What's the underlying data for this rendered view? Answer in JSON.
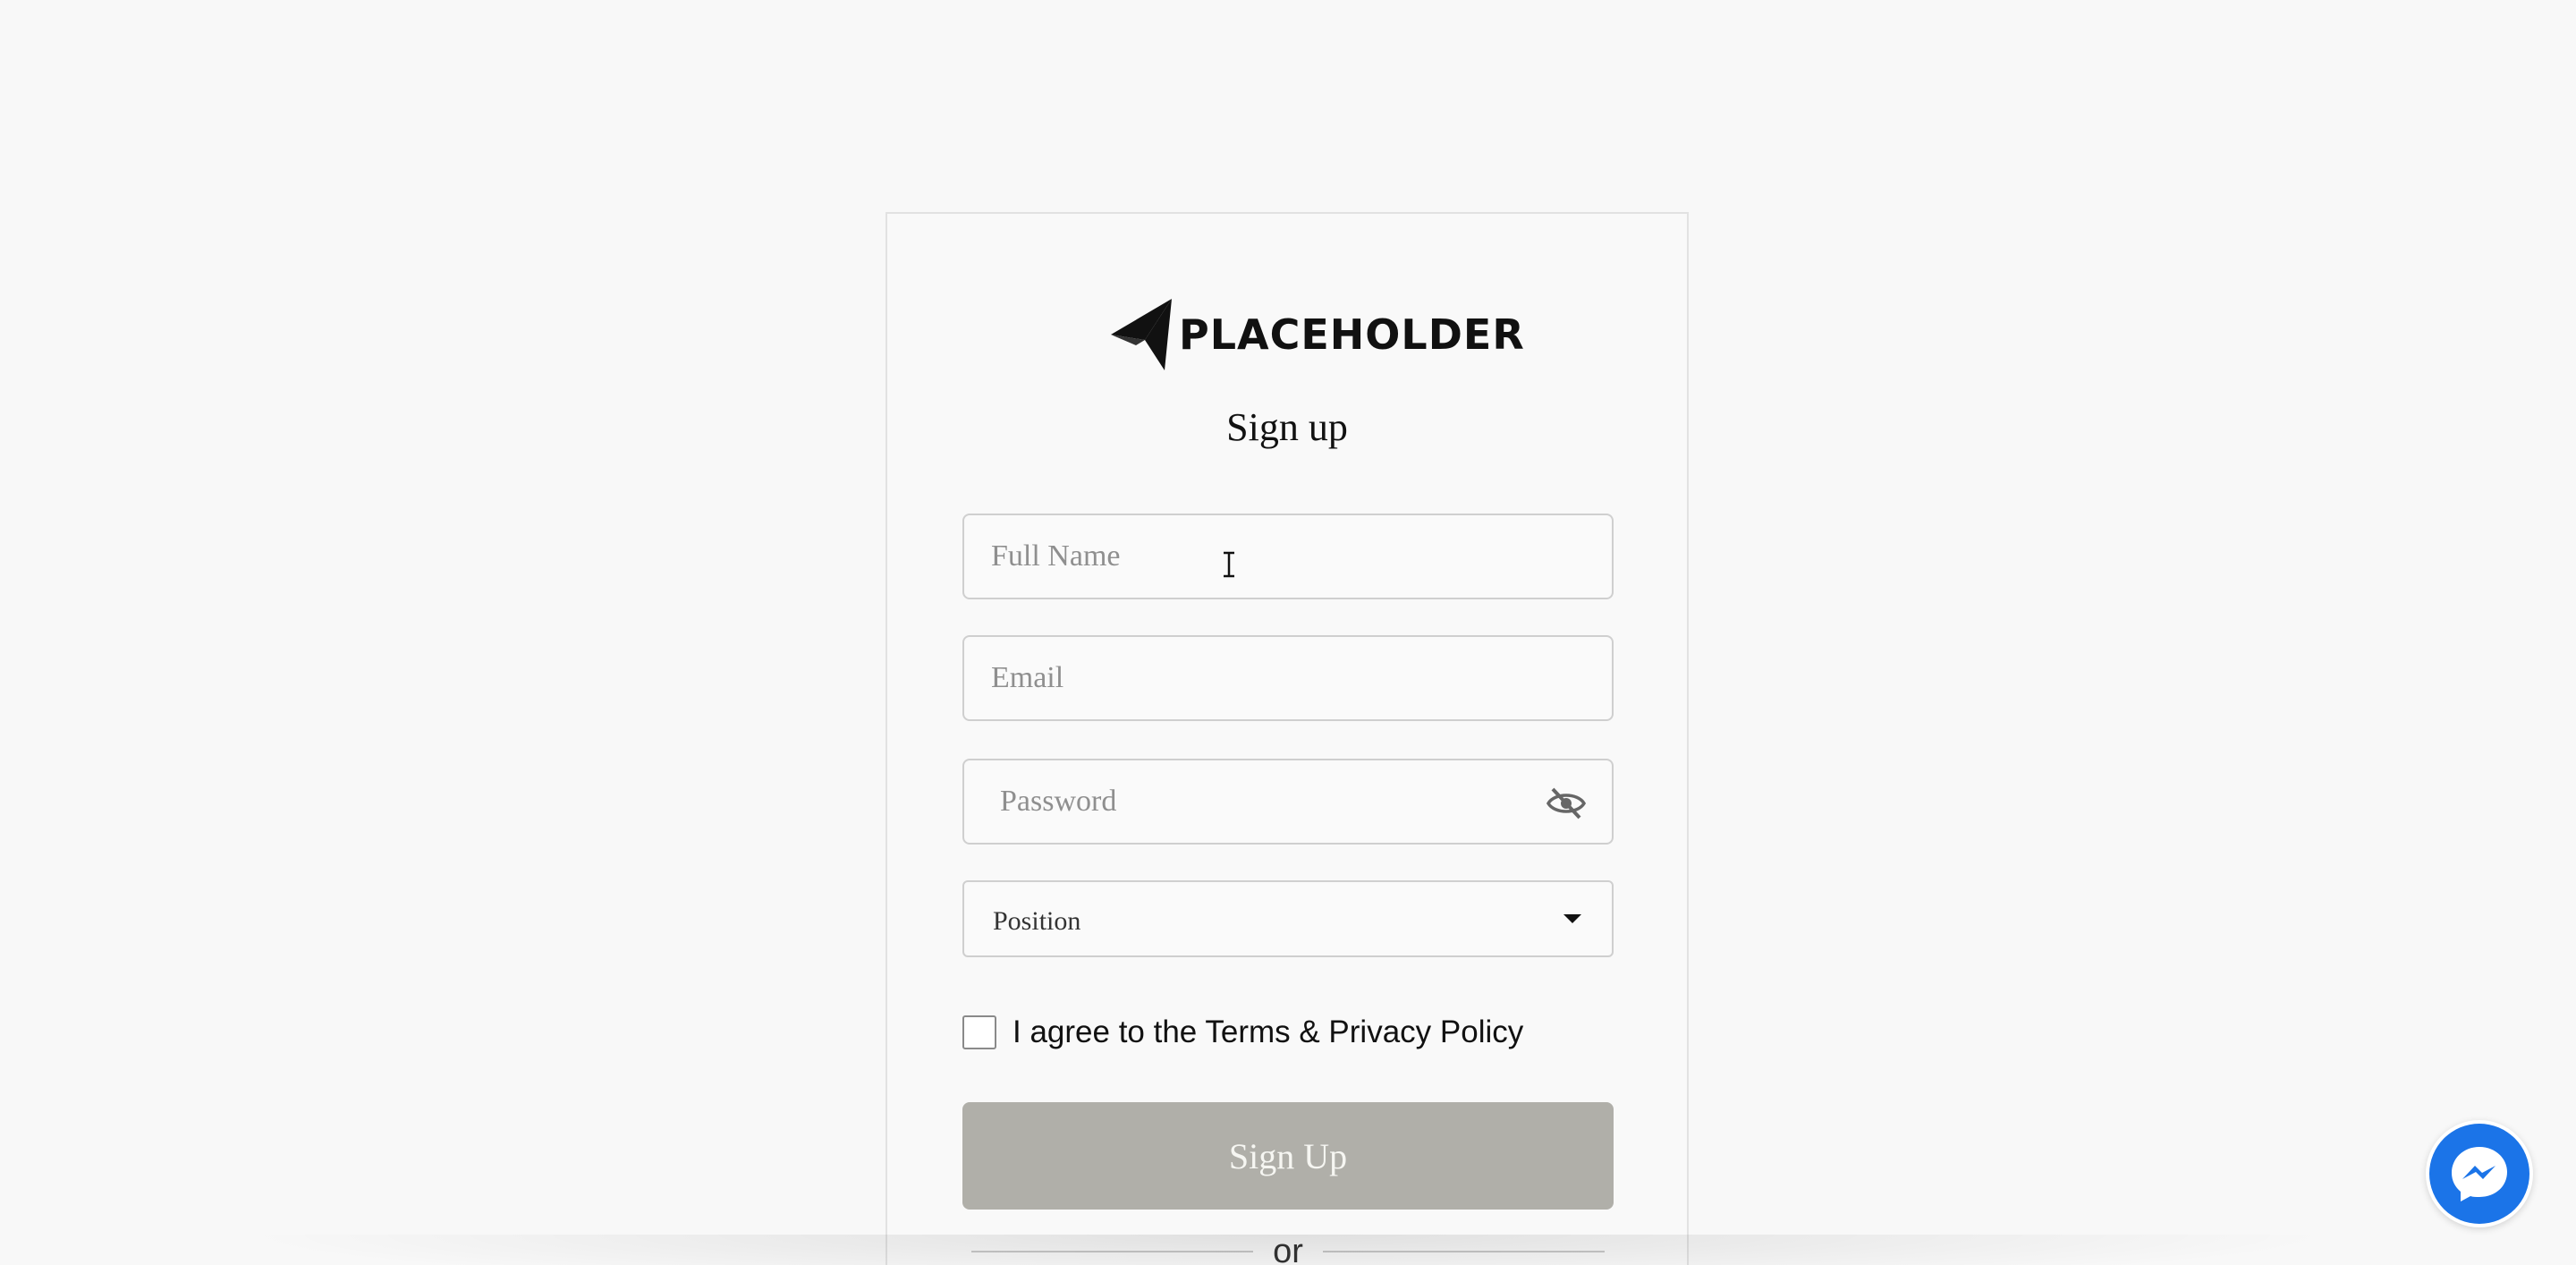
{
  "brand": {
    "name": "PLACEHOLDER",
    "logo_icon": "paper-plane-arrow-icon"
  },
  "form": {
    "title": "Sign up",
    "full_name": {
      "placeholder": "Full Name",
      "value": ""
    },
    "email": {
      "placeholder": "Email",
      "value": ""
    },
    "password": {
      "placeholder": "Password",
      "value": "",
      "visibility_icon": "eye-off-icon"
    },
    "position": {
      "label": "Position",
      "icon": "caret-down-icon"
    },
    "agree": {
      "checked": false,
      "label": "I agree to the Terms & Privacy Policy"
    },
    "submit_label": "Sign Up",
    "divider_text": "or"
  },
  "widgets": {
    "messenger_icon": "messenger-chat-icon"
  },
  "colors": {
    "button_disabled": "#b0afa9",
    "messenger_blue": "#1b74e8",
    "page_background": "#f8f8f8"
  }
}
